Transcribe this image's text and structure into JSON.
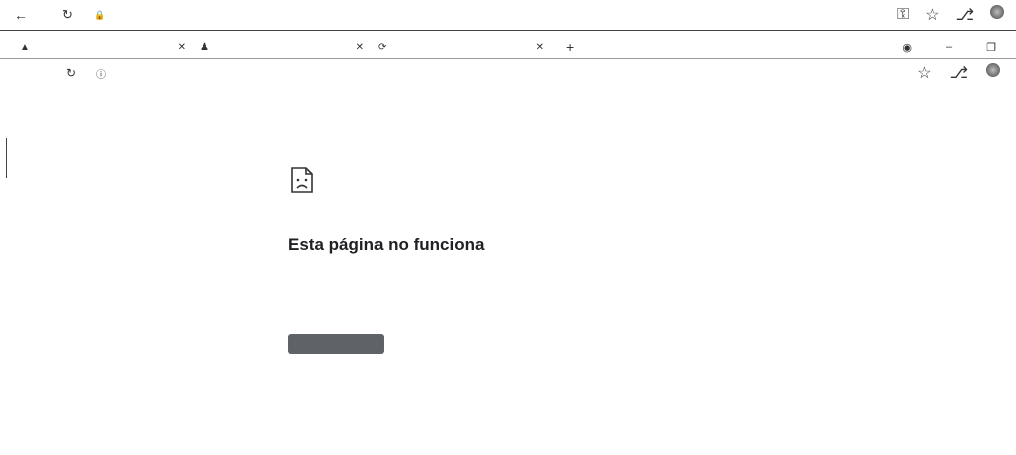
{
  "outer_window": {
    "url": "",
    "icons": [
      "back-arrow-icon",
      "reload-icon",
      "lock-icon",
      "key-icon",
      "star-icon",
      "extension-icon",
      "profile-avatar-icon"
    ]
  },
  "tabs": [
    {
      "title": "",
      "icon": "favicon-icon"
    },
    {
      "title": "",
      "icon": "person-favicon-icon"
    },
    {
      "title": "",
      "icon": "loading-favicon-icon"
    }
  ],
  "inner_window": {
    "url": "",
    "icons": [
      "reload-icon",
      "info-icon",
      "star-icon",
      "extension-icon",
      "profile-avatar-icon"
    ]
  },
  "error_page": {
    "icon": "sad-document-icon",
    "title": "Esta página no funciona",
    "detail": "",
    "error_code": "",
    "button_label": "",
    "button_color": "#5f6368"
  }
}
